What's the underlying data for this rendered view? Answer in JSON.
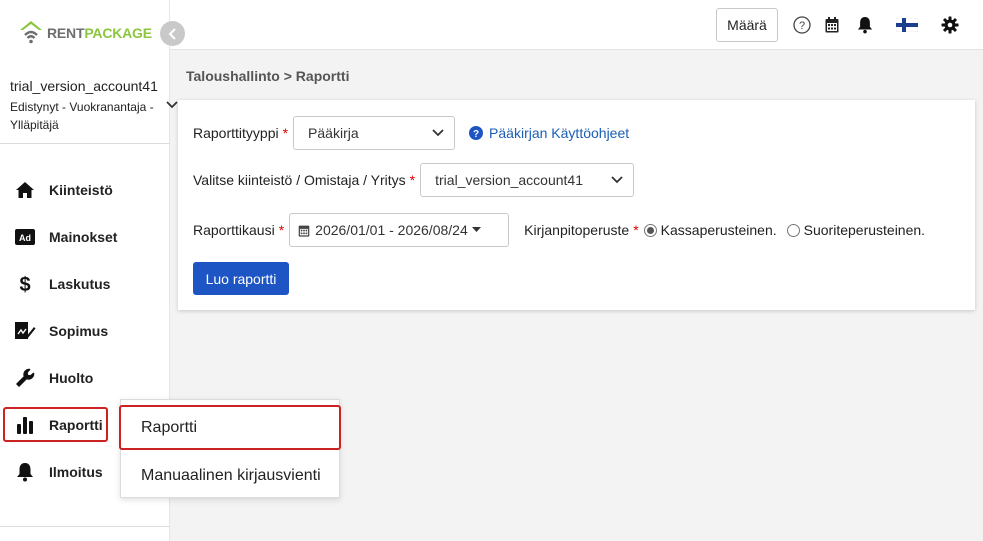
{
  "brand": {
    "name_part1": "RENT",
    "name_part2": "PACKAGE",
    "color_gray": "#6d6e70",
    "color_green": "#8cc63f"
  },
  "account": {
    "name": "trial_version_account41",
    "role": "Edistynyt - Vuokranantaja - Ylläpitäjä"
  },
  "nav": {
    "items": [
      {
        "label": "Kiinteistö",
        "icon": "home-icon"
      },
      {
        "label": "Mainokset",
        "icon": "ad-icon"
      },
      {
        "label": "Laskutus",
        "icon": "dollar-icon"
      },
      {
        "label": "Sopimus",
        "icon": "contract-sign-icon"
      },
      {
        "label": "Huolto",
        "icon": "wrench-icon"
      },
      {
        "label": "Raportti",
        "icon": "bar-chart-icon",
        "active": true
      },
      {
        "label": "Ilmoitus",
        "icon": "bell-icon"
      }
    ]
  },
  "submenu": {
    "items": [
      {
        "label": "Raportti"
      },
      {
        "label": "Manuaalinen kirjausvienti"
      }
    ]
  },
  "header": {
    "quantity_button": "Määrä",
    "icons": [
      "help-icon",
      "calendar-icon",
      "notification-bell-icon",
      "finland-flag-icon",
      "settings-gear-icon"
    ]
  },
  "breadcrumb": "Taloushallinto > Raportti",
  "form": {
    "report_type_label": "Raporttityyppi",
    "report_type_value": "Pääkirja",
    "help_link": "Pääkirjan Käyttöohjeet",
    "property_label": "Valitse kiinteistö / Omistaja / Yritys",
    "property_value": "trial_version_account41",
    "period_label": "Raporttikausi",
    "period_value": "2026/01/01 - 2026/08/24",
    "basis_label": "Kirjanpitoperuste",
    "basis_options": [
      {
        "label": "Kassaperusteinen.",
        "checked": true
      },
      {
        "label": "Suoriteperusteinen.",
        "checked": false
      }
    ],
    "required_mark": "*",
    "submit_label": "Luo raportti"
  },
  "colors": {
    "primary": "#1e55c5",
    "highlight_border": "#cc2222",
    "link": "#1a5fb4"
  }
}
